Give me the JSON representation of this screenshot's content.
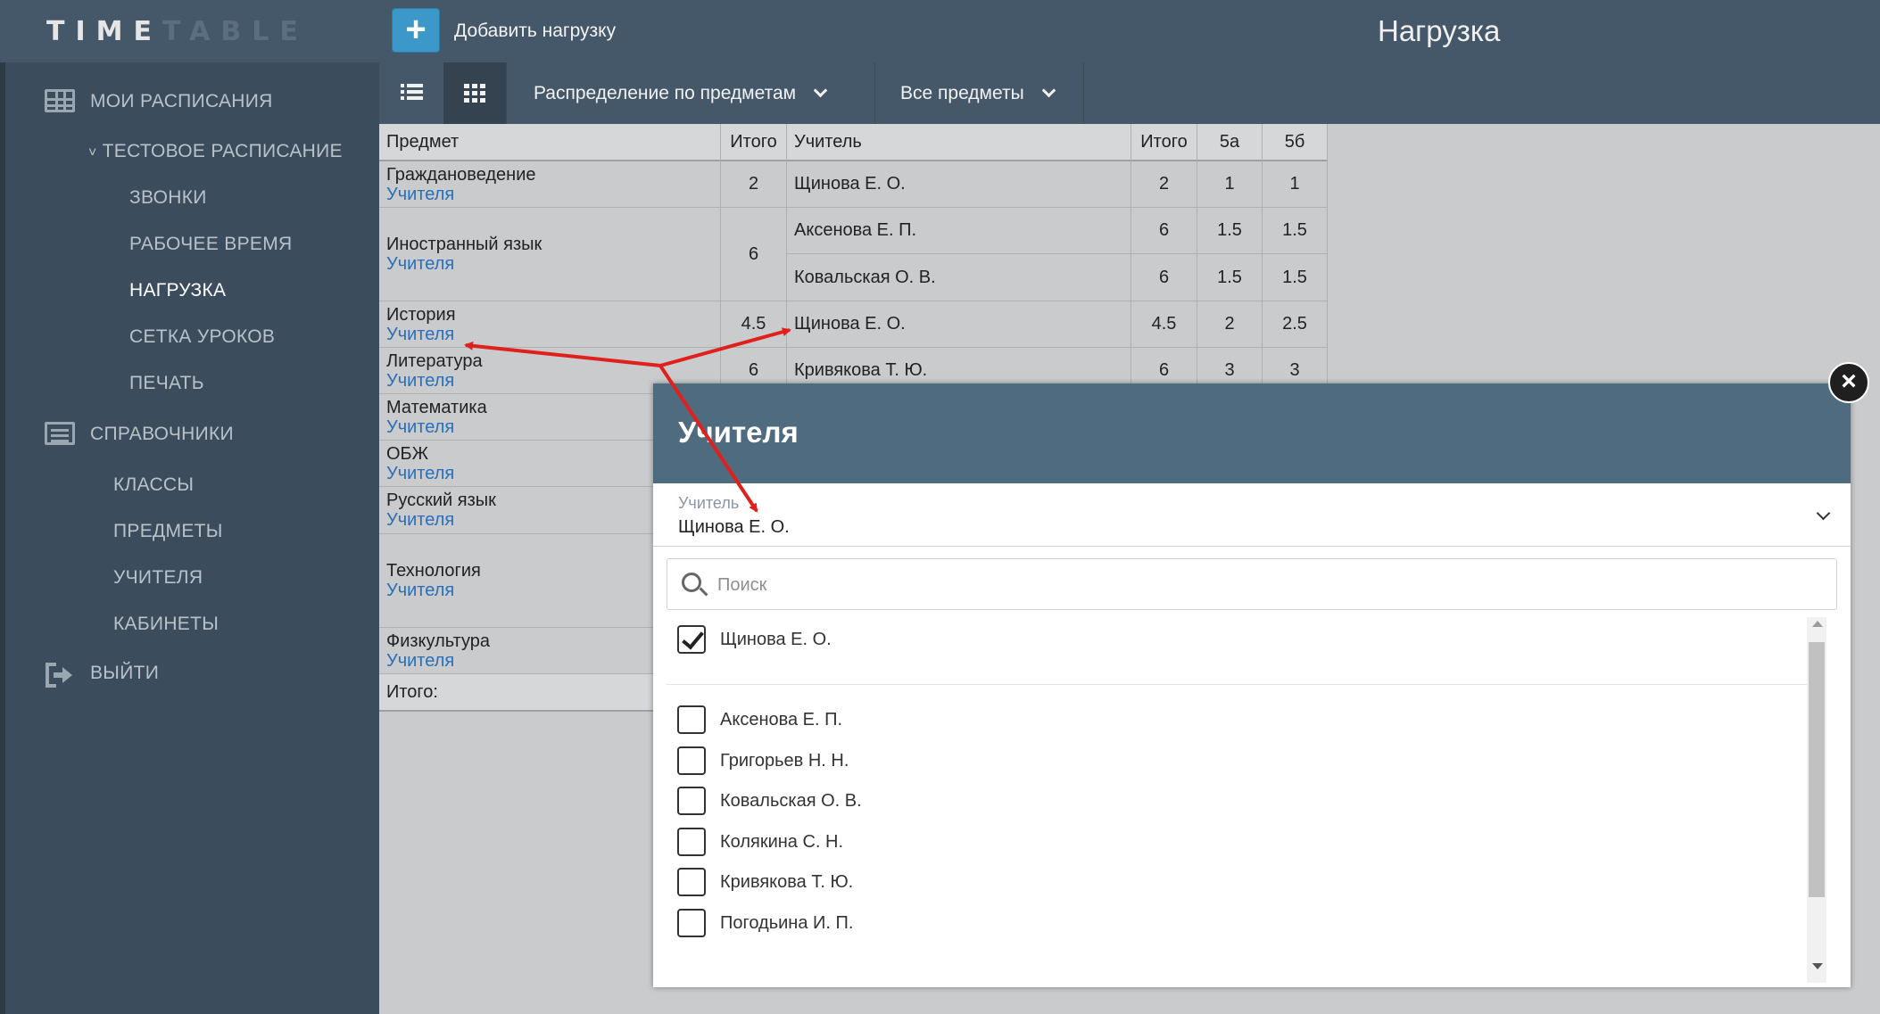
{
  "app": {
    "logo_bright": "TIME",
    "logo_dim": "TABLE",
    "add_button_label": "Добавить нагрузку",
    "page_title": "Нагрузка"
  },
  "sidebar": {
    "my_schedules": "МОИ РАСПИСАНИЯ",
    "test_schedule": "ТЕСТОВОЕ РАСПИСАНИЕ",
    "items": [
      "ЗВОНКИ",
      "РАБОЧЕЕ ВРЕМЯ",
      "НАГРУЗКА",
      "СЕТКА УРОКОВ",
      "ПЕЧАТЬ"
    ],
    "references": "СПРАВОЧНИКИ",
    "ref_items": [
      "КЛАССЫ",
      "ПРЕДМЕТЫ",
      "УЧИТЕЛЯ",
      "КАБИНЕТЫ"
    ],
    "logout": "ВЫЙТИ",
    "active_item": "НАГРУЗКА"
  },
  "toolbar": {
    "view_mode": "Распределение по предметам",
    "subject_filter": "Все предметы"
  },
  "table": {
    "headers": [
      "Предмет",
      "Итого",
      "Учитель",
      "Итого",
      "5а",
      "5б"
    ],
    "teachers_link": "Учителя",
    "subjects": [
      "Граждановедение",
      "Иностранный язык",
      "История",
      "Литература",
      "Математика",
      "ОБЖ",
      "Русский язык",
      "Технология",
      "Физкультура"
    ],
    "subject_totals": [
      "2",
      "6",
      "4.5",
      "6"
    ],
    "rows": [
      {
        "teacher": "Щинова Е. О.",
        "total": "2",
        "c5a": "1",
        "c5b": "1"
      },
      {
        "teacher": "Аксенова Е. П.",
        "total": "6",
        "c5a": "1.5",
        "c5b": "1.5"
      },
      {
        "teacher": "Ковальская О. В.",
        "total": "6",
        "c5a": "1.5",
        "c5b": "1.5"
      },
      {
        "teacher": "Щинова Е. О.",
        "total": "4.5",
        "c5a": "2",
        "c5b": "2.5"
      },
      {
        "teacher": "Кривякова Т. Ю.",
        "total": "6",
        "c5a": "3",
        "c5b": "3"
      }
    ],
    "footer": "Итого:"
  },
  "modal": {
    "title": "Учителя",
    "close_symbol": "×",
    "select_label": "Учитель",
    "select_value": "Щинова Е. О.",
    "search_placeholder": "Поиск",
    "options": [
      {
        "label": "Щинова Е. О.",
        "checked": true
      },
      {
        "label": "Аксенова Е. П.",
        "checked": false
      },
      {
        "label": "Григорьев Н. Н.",
        "checked": false
      },
      {
        "label": "Ковальская О. В.",
        "checked": false
      },
      {
        "label": "Колякина С. Н.",
        "checked": false
      },
      {
        "label": "Кривякова Т. Ю.",
        "checked": false
      },
      {
        "label": "Погодьина И. П.",
        "checked": false
      }
    ]
  },
  "colors": {
    "header_bg": "#45586a",
    "sidebar_bg": "#3b4d5c",
    "accent_button": "#3c98c8",
    "modal_header": "#4f6b80",
    "link": "#2a6fb8",
    "annotation_arrow": "#e0201c"
  }
}
